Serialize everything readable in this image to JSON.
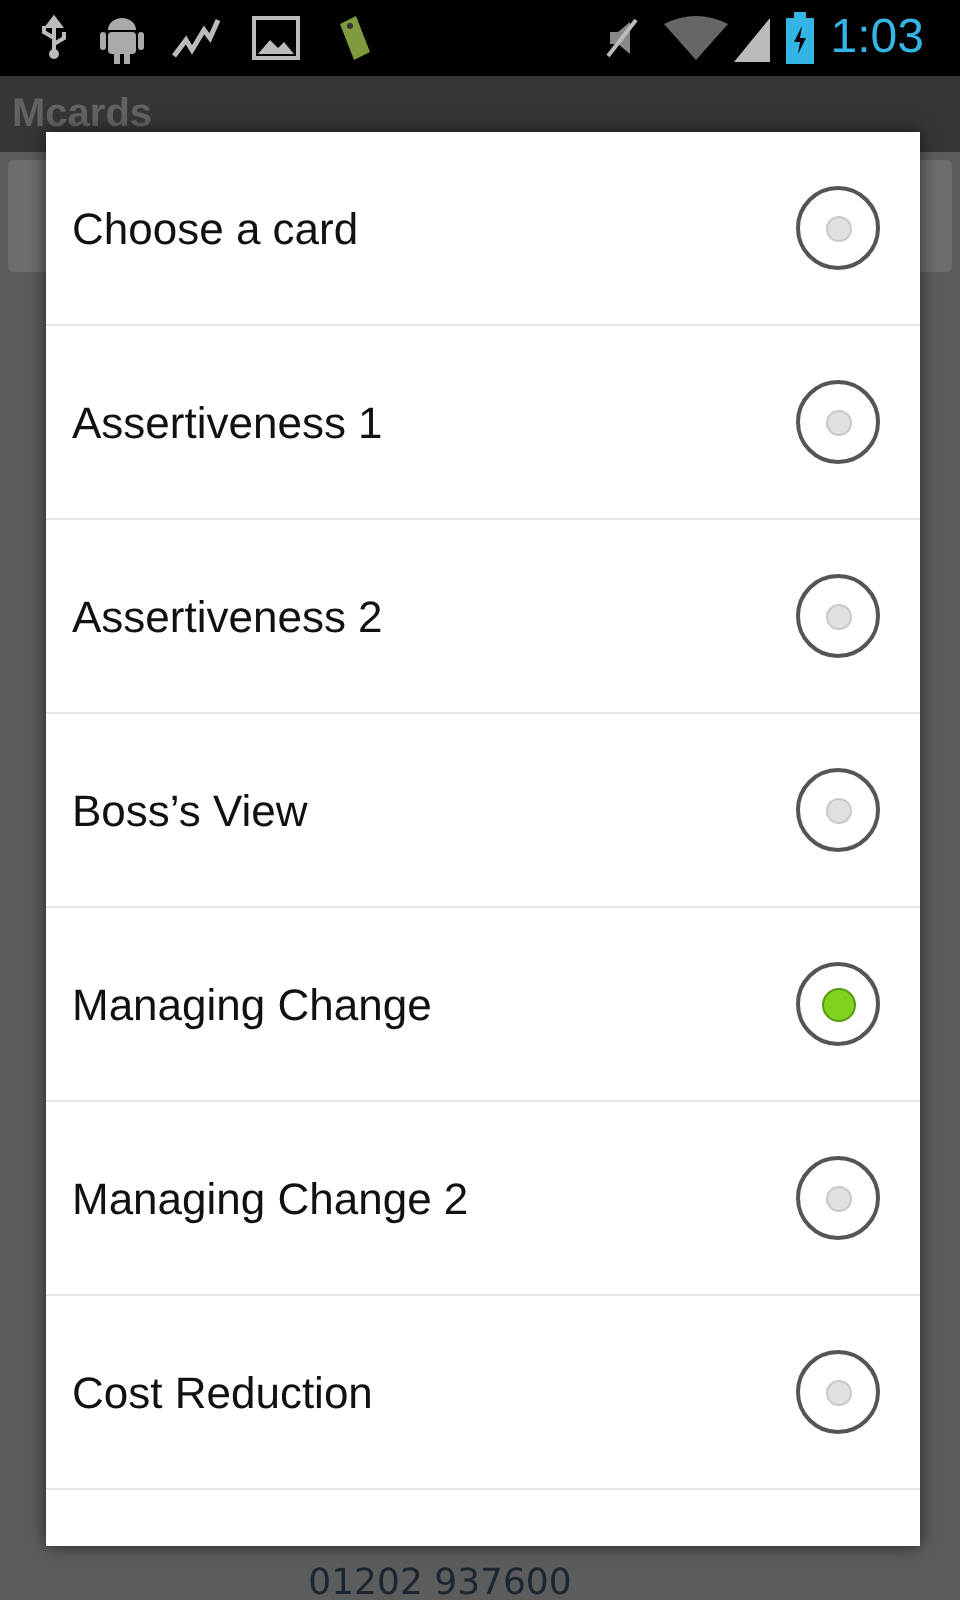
{
  "status_bar": {
    "time": "1:03"
  },
  "app": {
    "title": "Mcards",
    "phone": "01202 937600"
  },
  "dialog": {
    "options": [
      {
        "label": "Choose a card",
        "selected": false
      },
      {
        "label": "Assertiveness 1",
        "selected": false
      },
      {
        "label": "Assertiveness 2",
        "selected": false
      },
      {
        "label": "Boss’s View",
        "selected": false
      },
      {
        "label": "Managing Change",
        "selected": true
      },
      {
        "label": "Managing Change 2",
        "selected": false
      },
      {
        "label": "Cost Reduction",
        "selected": false
      }
    ]
  }
}
